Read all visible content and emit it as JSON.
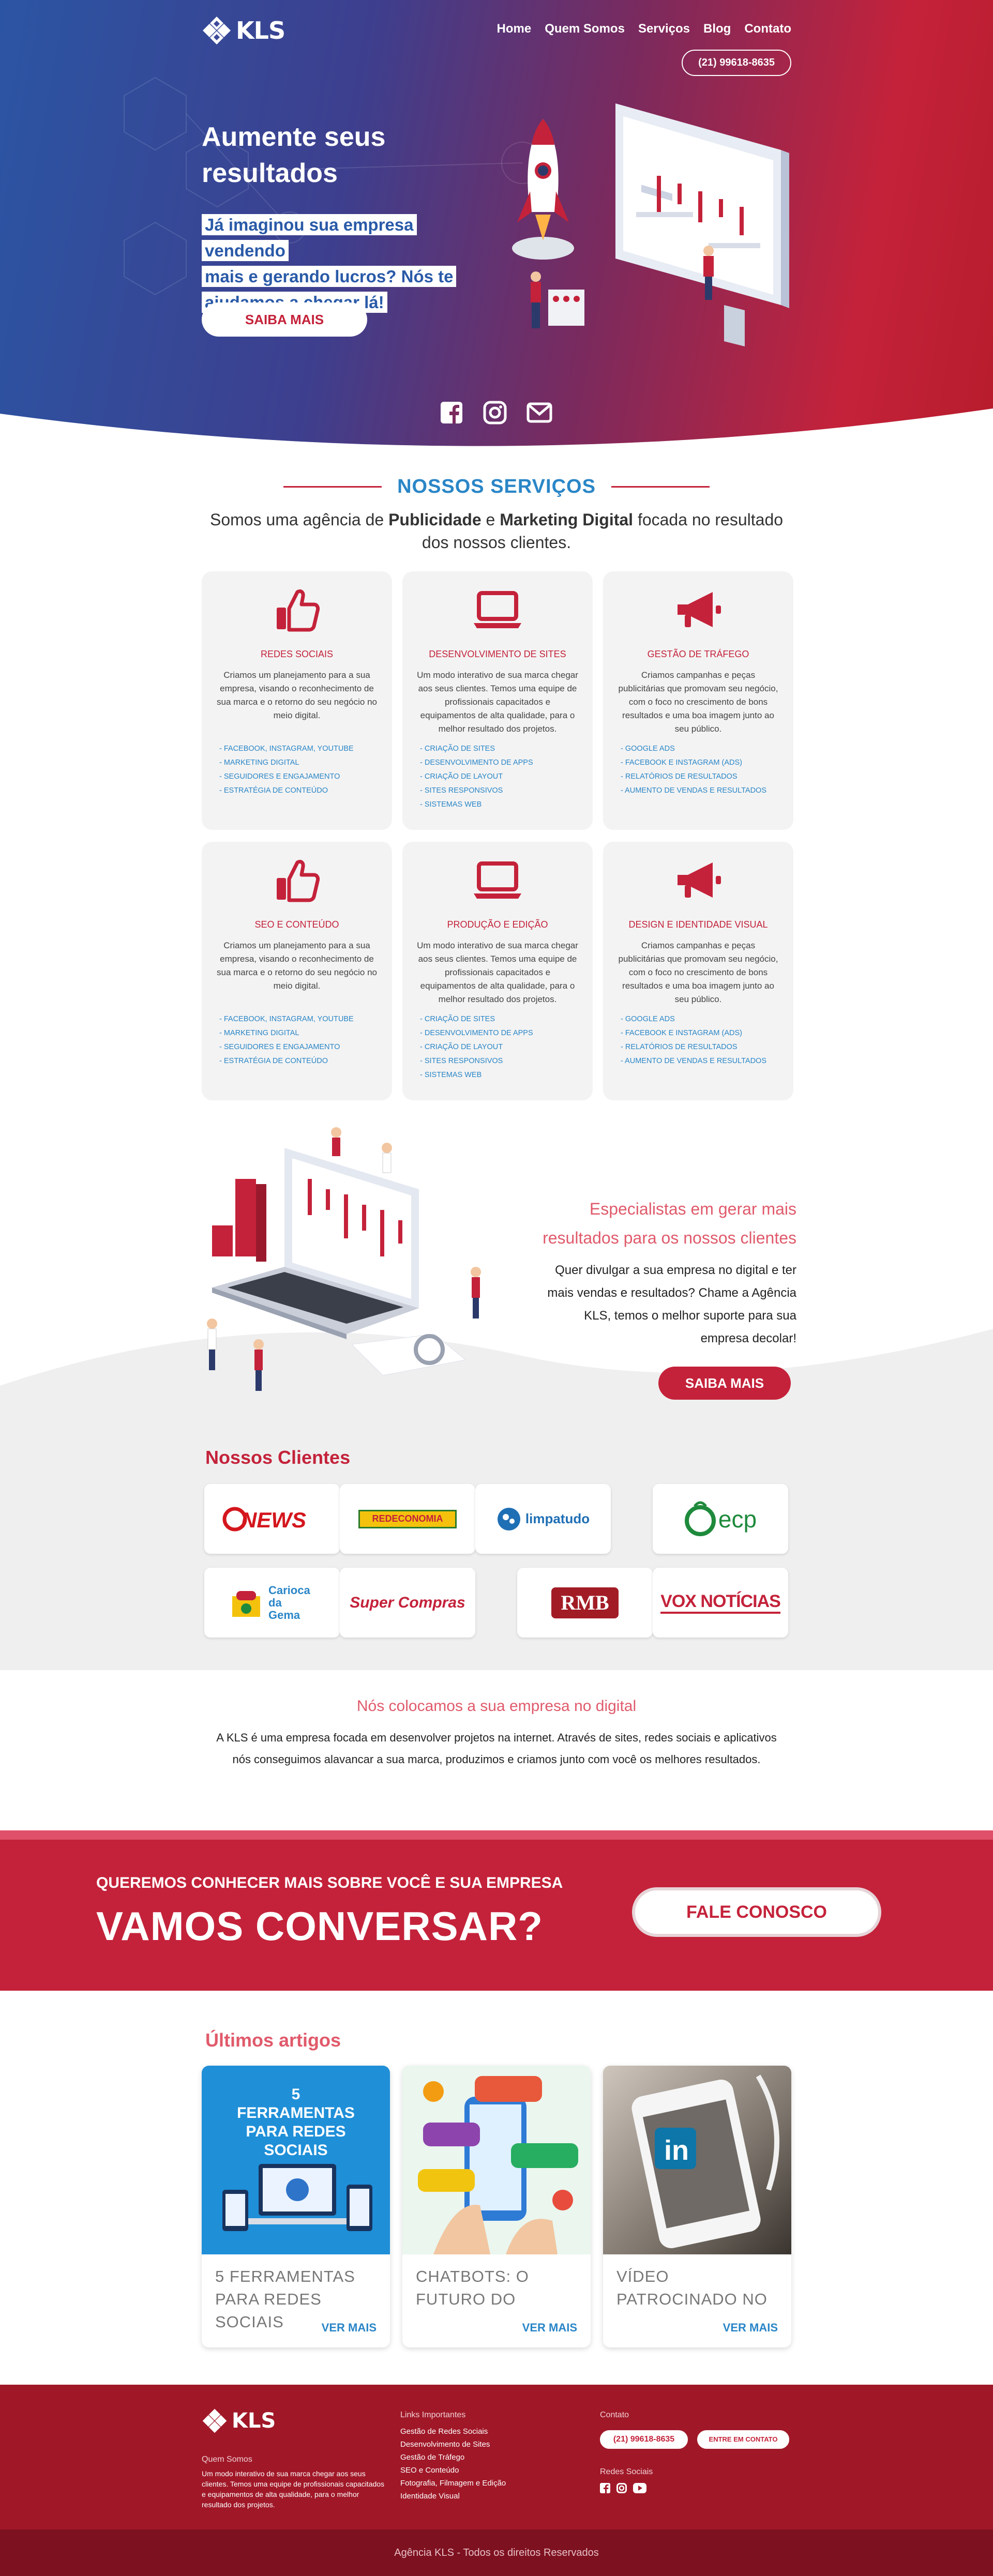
{
  "brand": {
    "name": "KLS"
  },
  "nav": {
    "items": [
      "Home",
      "Quem Somos",
      "Serviços",
      "Blog",
      "Contato"
    ],
    "phone": "(21) 99618-8635"
  },
  "hero": {
    "title": "Aumente seus resultados",
    "subtitle_lines": [
      "Já imaginou sua empresa vendendo",
      "mais e gerando lucros? Nós te",
      "ajudamos a chegar lá!"
    ],
    "cta": "SAIBA MAIS",
    "socials": [
      "facebook-icon",
      "instagram-icon",
      "email-icon"
    ]
  },
  "services": {
    "title": "NOSSOS SERVIÇOS",
    "intro_pre": "Somos uma agência de ",
    "intro_b1": "Publicidade",
    "intro_mid": " e ",
    "intro_b2": "Marketing Digital",
    "intro_post": " focada no resultado",
    "intro_line2": "dos nossos clientes.",
    "cards": [
      {
        "icon": "thumbs-up-icon",
        "title": "REDES SOCIAIS",
        "desc": "Criamos um planejamento para a sua empresa, visando o reconhecimento de sua marca e o retorno do seu negócio no meio digital.",
        "items": [
          "- FACEBOOK, INSTAGRAM, YOUTUBE",
          "- MARKETING DIGITAL",
          "- SEGUIDORES E ENGAJAMENTO",
          "- ESTRATÉGIA DE CONTEÚDO"
        ]
      },
      {
        "icon": "laptop-icon",
        "title": "DESENVOLVIMENTO DE SITES",
        "desc": "Um modo interativo de sua marca chegar aos seus clientes. Temos uma equipe de profissionais capacitados e equipamentos de alta qualidade, para o melhor resultado dos projetos.",
        "items": [
          "- CRIAÇÃO DE SITES",
          "- DESENVOLVIMENTO DE APPS",
          "- CRIAÇÃO DE LAYOUT",
          "- SITES RESPONSIVOS",
          "- SISTEMAS WEB"
        ]
      },
      {
        "icon": "megaphone-icon",
        "title": "GESTÃO DE TRÁFEGO",
        "desc": "Criamos campanhas e peças publicitárias que promovam seu negócio, com o foco no crescimento de bons resultados e uma boa imagem junto ao seu público.",
        "items": [
          "- GOOGLE ADS",
          "- FACEBOOK E INSTAGRAM (ADS)",
          "- RELATÓRIOS DE RESULTADOS",
          "- AUMENTO DE VENDAS E RESULTADOS"
        ]
      },
      {
        "icon": "thumbs-up-icon",
        "title": "SEO E CONTEÚDO",
        "desc": "Criamos um planejamento para a sua empresa, visando o reconhecimento de sua marca e o retorno do seu negócio no meio digital.",
        "items": [
          "- FACEBOOK, INSTAGRAM, YOUTUBE",
          "- MARKETING DIGITAL",
          "- SEGUIDORES E ENGAJAMENTO",
          "- ESTRATÉGIA DE CONTEÚDO"
        ]
      },
      {
        "icon": "laptop-icon",
        "title": "PRODUÇÃO E EDIÇÃO",
        "desc": "Um modo interativo de sua marca chegar aos seus clientes. Temos uma equipe de profissionais capacitados e equipamentos de alta qualidade, para o melhor resultado dos projetos.",
        "items": [
          "- CRIAÇÃO DE SITES",
          "- DESENVOLVIMENTO DE APPS",
          "- CRIAÇÃO DE LAYOUT",
          "- SITES RESPONSIVOS",
          "- SISTEMAS WEB"
        ]
      },
      {
        "icon": "megaphone-icon",
        "title": "DESIGN E IDENTIDADE VISUAL",
        "desc": "Criamos campanhas e peças publicitárias que promovam seu negócio, com o foco no crescimento de bons resultados e uma boa imagem junto ao seu público.",
        "items": [
          "- GOOGLE ADS",
          "- FACEBOOK E INSTAGRAM (ADS)",
          "- RELATÓRIOS DE RESULTADOS",
          "- AUMENTO DE VENDAS E RESULTADOS"
        ]
      }
    ]
  },
  "specialists": {
    "title_l1": "Especialistas em gerar mais",
    "title_l2": "resultados para os nossos clientes",
    "text_lines": [
      "Quer divulgar a sua empresa no digital e ter",
      "mais vendas e resultados? Chame a Agência",
      "KLS, temos o melhor suporte para sua",
      "empresa decolar!"
    ],
    "cta": "SAIBA MAIS"
  },
  "clients": {
    "title": "Nossos Clientes",
    "logos": [
      "NEWS",
      "REDECONOMIA",
      "limpatudo",
      "ecp",
      "Carioca da Gema",
      "Super Compras",
      "RMB",
      "VOX NOTÍCIAS"
    ]
  },
  "about": {
    "title": "Nós colocamos a sua empresa no digital",
    "text": "A KLS é uma empresa focada em desenvolver projetos na internet. Através de sites, redes sociais e aplicativos nós conseguimos alavancar a sua marca, produzimos e criamos junto com você os melhores resultados."
  },
  "banner": {
    "subtitle": "QUEREMOS CONHECER MAIS SOBRE VOCÊ E SUA EMPRESA",
    "title": "VAMOS CONVERSAR?",
    "cta": "FALE CONOSCO"
  },
  "articles": {
    "title": "Últimos artigos",
    "items": [
      {
        "title_l1": "5 FERRAMENTAS",
        "title_l2": "PARA REDES SOCIAIS",
        "more": "VER MAIS",
        "img_text": "5 FERRAMENTAS PARA REDES SOCIAIS"
      },
      {
        "title_l1": "CHATBOTS: O",
        "title_l2": "FUTURO DO",
        "more": "VER MAIS"
      },
      {
        "title_l1": "VÍDEO",
        "title_l2": "PATROCINADO NO",
        "more": "VER MAIS"
      }
    ]
  },
  "footer": {
    "about_label": "Quem Somos",
    "about_text": "Um modo interativo de sua marca chegar aos seus clientes. Temos uma equipe de profissionais capacitados e equipamentos de alta qualidade, para o melhor resultado dos projetos.",
    "links_label": "Links Importantes",
    "links": [
      "Gestão de Redes Sociais",
      "Desenvolvimento de Sites",
      "Gestão de Tráfego",
      "SEO e Conteúdo",
      "Fotografia, Filmagem e Edição",
      "Identidade Visual"
    ],
    "contact_label": "Contato",
    "phone": "(21) 99618-8635",
    "contact_btn": "ENTRE EM CONTATO",
    "socials_label": "Redes Sociais",
    "copyright": "Agência KLS - Todos os direitos Reservados"
  },
  "colors": {
    "primary_red": "#c4223a",
    "blue": "#2a86c7",
    "dark_red": "#a01828"
  }
}
